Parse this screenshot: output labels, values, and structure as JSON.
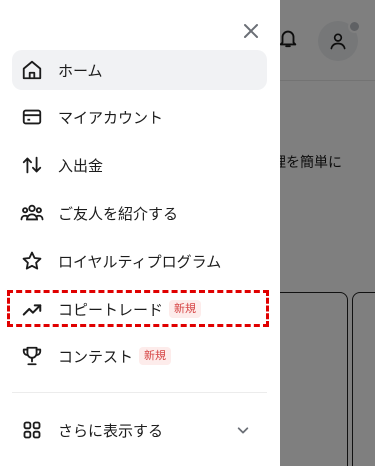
{
  "background": {
    "partial_text": "管理を簡単に"
  },
  "drawer": {
    "close_icon": "close-icon",
    "items": [
      {
        "label": "ホーム",
        "icon": "home-icon",
        "active": true
      },
      {
        "label": "マイアカウント",
        "icon": "card-icon"
      },
      {
        "label": "入出金",
        "icon": "transfer-arrows-icon"
      },
      {
        "label": "ご友人を紹介する",
        "icon": "users-icon"
      },
      {
        "label": "ロイヤルティプログラム",
        "icon": "star-icon"
      },
      {
        "label": "コピートレード",
        "icon": "trending-up-icon",
        "badge": "新規",
        "highlighted": true
      },
      {
        "label": "コンテスト",
        "icon": "trophy-icon",
        "badge": "新規"
      }
    ],
    "more": {
      "label": "さらに表示する",
      "icon": "grid-icon",
      "chevron": "chevron-down-icon"
    }
  },
  "colors": {
    "badge_text": "#d64545",
    "badge_bg": "#fdeceb",
    "highlight": "#e00000",
    "active_bg": "#f1f2f4"
  }
}
